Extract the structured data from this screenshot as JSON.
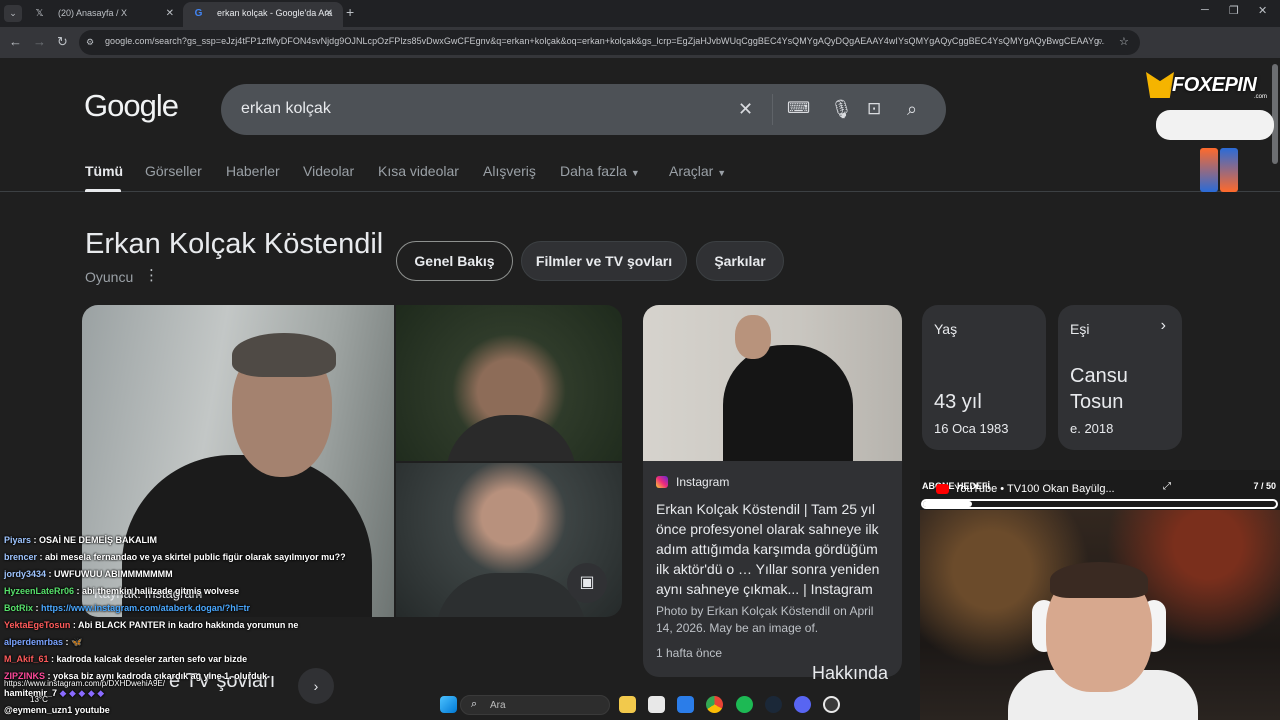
{
  "browser": {
    "tabs": [
      {
        "title": "(20) Anasayfa / X",
        "icon": "x-logo-icon"
      },
      {
        "title": "erkan kolçak - Google'da Ara",
        "icon": "google-icon",
        "active": true
      }
    ],
    "url": "google.com/search?gs_ssp=eJzj4tFP1zfMyDFON4svNjdg9OJNLcpOzFPlzs85vDwxGwCFEgnv&q=erkan+kolçak&oq=erkan+kolçak&gs_lcrp=EgZjaHJvbWUqCggBEC4YsQMYgAQyDQgAEAAY4wIYsQMYgAQyCggBEC4YsQMYgAQyBwgCEAAYg..."
  },
  "google": {
    "logo": "Google",
    "query": "erkan kolçak",
    "nav": [
      "Tümü",
      "Görseller",
      "Haberler",
      "Videolar",
      "Kısa videolar",
      "Alışveriş",
      "Daha fazla",
      "Araçlar"
    ],
    "active_nav": "Tümü"
  },
  "entity": {
    "title": "Erkan Kolçak Köstendil",
    "subtitle": "Oyuncu",
    "chips": [
      "Genel Bakış",
      "Filmler ve TV şovları",
      "Şarkılar"
    ],
    "image_source": "Kaynak: Instagram"
  },
  "instagram_card": {
    "source": "Instagram",
    "title": "Erkan Kolçak Köstendil | Tam 25 yıl önce profesyonel olarak sahneye ilk adım attığımda karşımda gördüğüm ilk aktör'dü o … Yıllar sonra yeniden aynı sahneye çıkmak... | Instagram",
    "description": "Photo by Erkan Kolçak Köstendil on April 14, 2026. May be an image of.",
    "time": "1 hafta önce"
  },
  "facts": {
    "age": {
      "label": "Yaş",
      "value": "43 yıl",
      "sub": "16 Oca 1983"
    },
    "spouse": {
      "label": "Eşi",
      "value_line1": "Cansu",
      "value_line2": "Tosun",
      "sub": "e. 2018"
    }
  },
  "bottom": {
    "section_text": "e TV şovları",
    "right_text": "Hakkında"
  },
  "overlay": {
    "sponsor": "FOXEPIN",
    "sponsor_sub": ".com",
    "goal_label": "ABONE HEDEFİ",
    "goal_count": "7 / 50",
    "goal_fraction": 0.14,
    "youtube_line": "YouTube • TV100 Okan Bayülg...",
    "chat": [
      {
        "nick": "Piyars",
        "nick_color": "#9fc5ff",
        "msg": "OSAİ NE DEMEİŞ BAKALIM"
      },
      {
        "nick": "brencer",
        "nick_color": "#9fc5ff",
        "msg": "abi mesela fernandao ve ya skirtel public figür olarak sayılmıyor mu??"
      },
      {
        "nick": "jordy3434",
        "nick_color": "#9fc5ff",
        "msg": "UWFUWUU ABIMMMMMMM"
      },
      {
        "nick": "HyzeenLateRr06",
        "nick_color": "#57e06b",
        "msg": "abi themkin halilzade gitmiş wolvese"
      },
      {
        "nick": "BotRix",
        "nick_color": "#57e06b",
        "msg": "https://www.instagram.com/ataberk.dogan/?hl=tr",
        "is_link": true
      },
      {
        "nick": "YektaEgeTosun",
        "nick_color": "#ff5b5b",
        "msg": "Abi BLACK PANTER in kadro hakkında yorumun ne"
      },
      {
        "nick": "alperdemrbas",
        "nick_color": "#7aa3ff",
        "msg": "🦋"
      },
      {
        "nick": "M_Akif_61",
        "nick_color": "#ff5b5b",
        "msg": "kadroda kalcak deseler zarten sefo var bizde"
      },
      {
        "nick": "ZIPZINKS",
        "nick_color": "#ff4a9a",
        "msg": "yoksa biz aynı kadroda çıkardık ag yine 1. olurduk"
      },
      {
        "nick": "hamitemir_7",
        "nick_color": "#ffffff",
        "msg": ""
      },
      {
        "nick": "",
        "nick_color": "#ffffff",
        "msg": "@eymenn_uzn1 youtube"
      }
    ],
    "chat_link": "https://www.instagram.com/p/DXHDwehiA9E/",
    "weather": "13°C"
  },
  "taskbar": {
    "search_placeholder": "Ara"
  }
}
